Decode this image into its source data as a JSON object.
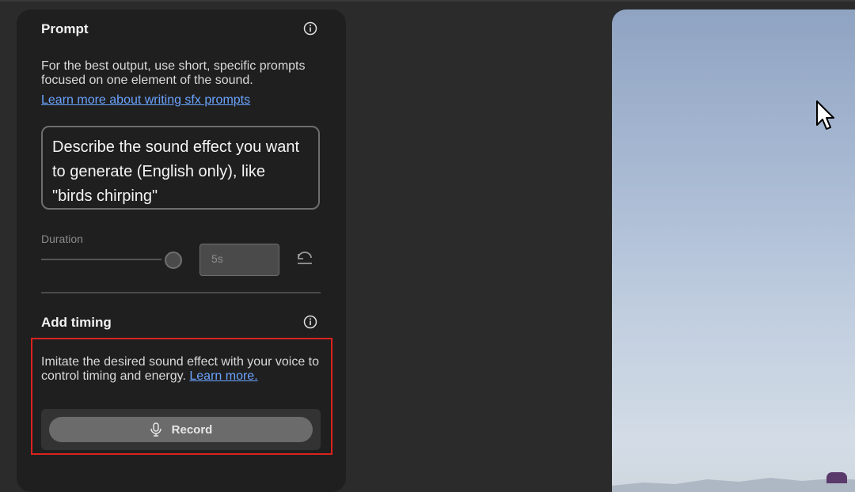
{
  "prompt_section": {
    "title": "Prompt",
    "description": "For the best output, use short, specific prompts focused on one element of the sound.",
    "link": "Learn more about writing sfx prompts",
    "placeholder": "Describe the sound effect you want to generate (English only), like \"birds chirping\""
  },
  "duration": {
    "label": "Duration",
    "value": "5s"
  },
  "timing_section": {
    "title": "Add timing",
    "description_prefix": "Imitate the desired sound effect with your voice to control timing and energy.",
    "learn_more": "Learn more.",
    "record_label": "Record"
  },
  "icons": {
    "info": "info-icon",
    "reset": "reset-icon",
    "mic": "microphone-icon",
    "cursor": "cursor-arrow-icon"
  },
  "colors": {
    "panel": "#1f1f1f",
    "link": "#6aa3ff",
    "highlight": "#d9231f"
  }
}
